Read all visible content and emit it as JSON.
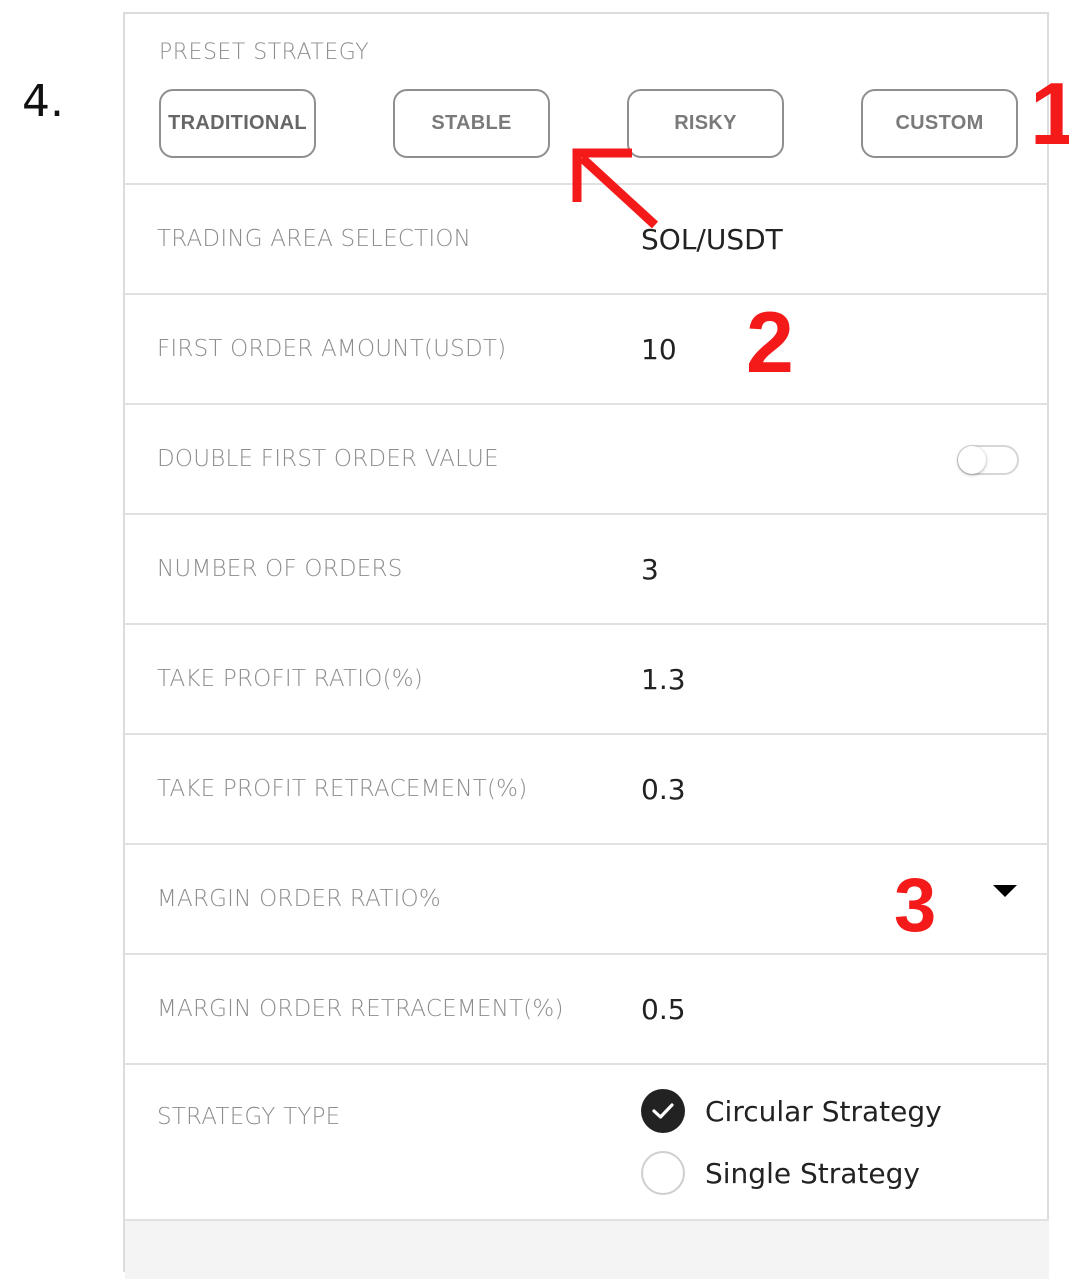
{
  "step": "4.",
  "preset": {
    "title": "PRESET STRATEGY",
    "buttons": [
      "TRADITIONAL",
      "STABLE",
      "RISKY",
      "CUSTOM"
    ]
  },
  "rows": {
    "trading_area": {
      "label": "TRADING AREA SELECTION",
      "value": "SOL/USDT"
    },
    "first_order_amount": {
      "label": "FIRST ORDER AMOUNT(USDT)",
      "value": "10"
    },
    "double_first_order": {
      "label": "DOUBLE FIRST ORDER VALUE",
      "enabled": false
    },
    "number_of_orders": {
      "label": "NUMBER OF ORDERS",
      "value": "3"
    },
    "take_profit_ratio": {
      "label": "TAKE PROFIT RATIO(%)",
      "value": "1.3"
    },
    "take_profit_retracement": {
      "label": "TAKE PROFIT RETRACEMENT(%)",
      "value": "0.3"
    },
    "margin_order_ratio": {
      "label": "MARGIN ORDER RATIO%"
    },
    "margin_order_retracement": {
      "label": "MARGIN ORDER RETRACEMENT(%)",
      "value": "0.5"
    },
    "strategy_type": {
      "label": "STRATEGY TYPE",
      "options": [
        {
          "label": "Circular Strategy",
          "selected": true
        },
        {
          "label": "Single Strategy",
          "selected": false
        }
      ]
    }
  },
  "annotations": {
    "one": "1",
    "two": "2",
    "three": "3"
  },
  "colors": {
    "annotation": "#f41a1a",
    "label": "#8c8c8c",
    "value": "#222222"
  }
}
